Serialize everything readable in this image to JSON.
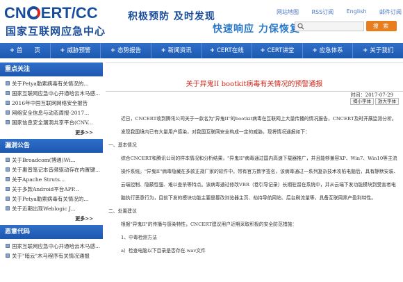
{
  "header": {
    "logo_en": "CNCERT/CC",
    "logo_cn": "国家互联网应急中心",
    "slogan1": "积极预防 及时发现",
    "slogan2": "快速响应 力保恢复",
    "top_links": [
      "网站地图",
      "RSS订阅",
      "English",
      "邮件订阅"
    ],
    "search_placeholder": "",
    "search_button": "搜 索"
  },
  "nav": [
    {
      "label": "首　　页"
    },
    {
      "label": "威胁预警"
    },
    {
      "label": "态势报告"
    },
    {
      "label": "新闻资讯"
    },
    {
      "label": "CERT在线"
    },
    {
      "label": "CERT讲堂"
    },
    {
      "label": "应急体系"
    },
    {
      "label": "关于我们"
    }
  ],
  "sidebar": {
    "sections": [
      {
        "title": "重点关注",
        "items": [
          "关于Petya勒索病毒有关情况的...",
          "国家互联网应急中心开通哈云木马感...",
          "2016年中国互联网网络安全报告",
          "网络安全信息与动态周报-2017...",
          "国家信息安全漏洞共享平台(CNV..."
        ],
        "more": "更多>>"
      },
      {
        "title": "漏洞公告",
        "items": [
          "关于Broadcom(博通)Wi...",
          "关于惠普笔记本音频驱动存在内置键...",
          "关于Apache Struts...",
          "关于多款Android平台APP...",
          "关于Petya勒索病毒有关情况的...",
          "关于近期出现Weblogic J..."
        ],
        "more": "更多>>"
      },
      {
        "title": "恶意代码",
        "items": [
          "国家互联网应急中心开通哈云木马感...",
          "关于\"暗云\"木马程序有关情况通报"
        ],
        "more": ""
      }
    ]
  },
  "article": {
    "title": "关于异鬼II bootkit病毒有关情况的预警通报",
    "time": "时间：2017-07-29",
    "font_small": "揭小字体",
    "font_large": "放大字体",
    "paragraphs": [
      "近日，CNCERT收到腾讯公司关于一款名为\"异鬼II\"的bootkit病毒在互联网上大量传播的情况报告，CNCERT及时开展监测分析。发现我国境内已有大量用户感染，对我国互联网安全构成一定的威胁。现将情况通报如下：",
      "一、基本情况",
      "综合CNCERT和腾讯公司的样本情况和分析结果，\"异鬼II\"病毒通过国内高速下载器推广，并且能够兼容XP、Win7、Win10等主流操作系统。\"异鬼II\"病毒隐藏在多款正规厂家的软件中，带有官方数字签名，该病毒通过一系列复杂技术攻陷电脑后，具有静默安装、云端控制、隐蔽性强、难以查杀等特点。该病毒通过修改VBR（卷引导记录）长期驻留在系统中，并从云端下发功能模块到受害者电脑执行恶意行为，目前下发的模块功能主要是篡改浏览器主页、劫持导航网站、后台刷流量等，具备互联网黑产盈利特性。",
      "二、处置建议",
      "根据\"异鬼II\"的传播与感染特性，CNCERT建议用户近期采取积极的安全防范措施：",
      "1、中毒检测方法",
      "a）检查电脑以下目录是否存在.wav文件"
    ]
  }
}
